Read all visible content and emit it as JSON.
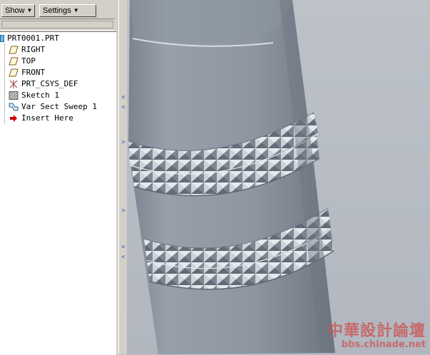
{
  "toolbar": {
    "show_label": "Show",
    "settings_label": "Settings"
  },
  "model_tree": {
    "root": "PRT0001.PRT",
    "items": [
      {
        "label": "RIGHT",
        "icon": "datum-plane-icon"
      },
      {
        "label": "TOP",
        "icon": "datum-plane-icon"
      },
      {
        "label": "FRONT",
        "icon": "datum-plane-icon"
      },
      {
        "label": "PRT_CSYS_DEF",
        "icon": "coordinate-system-icon"
      },
      {
        "label": "Sketch 1",
        "icon": "sketch-icon"
      },
      {
        "label": "Var Sect Sweep 1",
        "icon": "sweep-icon"
      },
      {
        "label": "Insert Here",
        "icon": "insert-arrow-icon"
      }
    ]
  },
  "watermark": {
    "chinese": "中華設計論壇",
    "url": "bbs.chinade.net"
  },
  "colors": {
    "panel_bg": "#d4d0c8",
    "tree_bg": "#ffffff",
    "viewport_bg": "#b9bec6",
    "model_color": "#8e98a2",
    "watermark": "#cd5050",
    "insert_arrow": "#cc0000"
  }
}
